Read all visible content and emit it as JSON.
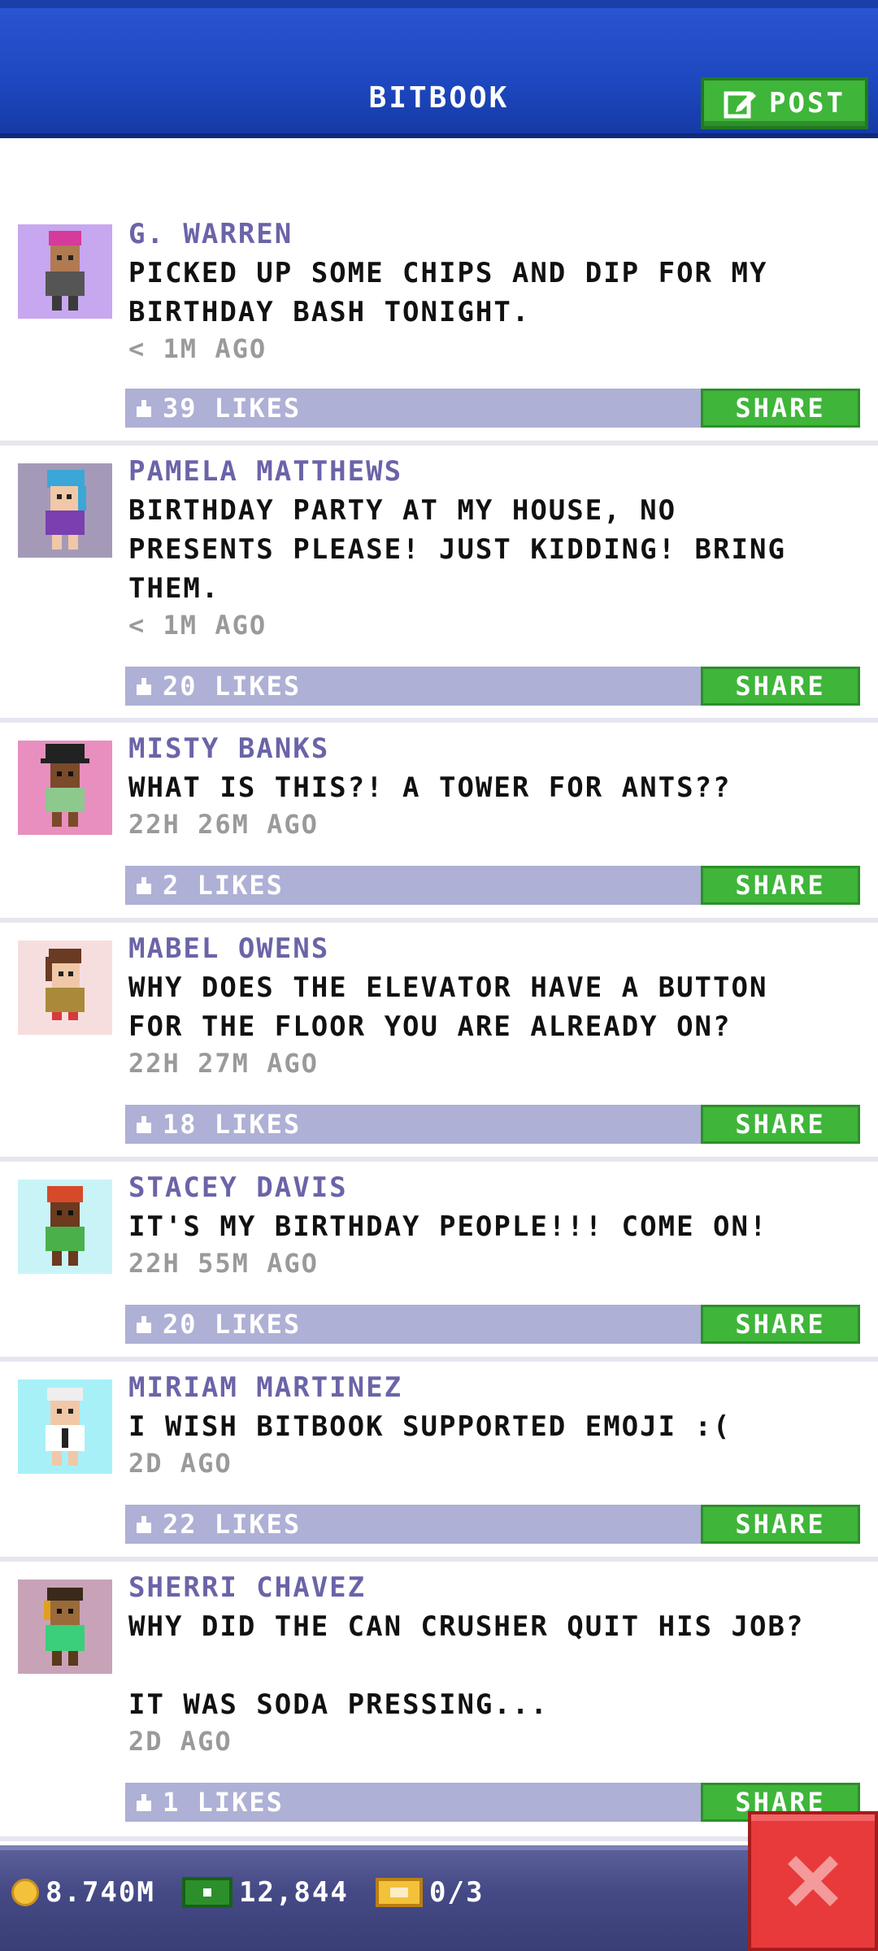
{
  "header": {
    "title": "BITBOOK",
    "post_label": "POST"
  },
  "feed": [
    {
      "author": "G. WARREN",
      "message": "PICKED UP SOME CHIPS AND DIP FOR MY\nBIRTHDAY BASH TONIGHT.",
      "time": "< 1M AGO",
      "likes": "39 LIKES",
      "share": "SHARE",
      "avatar": {
        "bg": "#c7a7ef",
        "hair": "#d63a9a",
        "skin": "#b07a52",
        "shirt": "#555555"
      }
    },
    {
      "author": "PAMELA MATTHEWS",
      "message": "BIRTHDAY PARTY AT MY HOUSE, NO\nPRESENTS PLEASE! JUST KIDDING! BRING\nTHEM.",
      "time": "< 1M AGO",
      "likes": "20 LIKES",
      "share": "SHARE",
      "avatar": {
        "bg": "#a49ab8",
        "hair": "#3aa7d6",
        "skin": "#f0c8a8",
        "shirt": "#7b3fb0"
      }
    },
    {
      "author": "MISTY BANKS",
      "message": "WHAT IS THIS?! A TOWER FOR ANTS??",
      "time": "22H 26M AGO",
      "likes": "2 LIKES",
      "share": "SHARE",
      "avatar": {
        "bg": "#e88fbf",
        "hair": "#222222",
        "skin": "#7a4a2a",
        "shirt": "#8dc88d"
      }
    },
    {
      "author": "MABEL OWENS",
      "message": "WHY DOES THE ELEVATOR HAVE A BUTTON\nFOR THE FLOOR YOU ARE ALREADY ON?",
      "time": "22H 27M AGO",
      "likes": "18 LIKES",
      "share": "SHARE",
      "avatar": {
        "bg": "#f7dede",
        "hair": "#6b3a22",
        "skin": "#f0c8a8",
        "shirt": "#a88a3a"
      }
    },
    {
      "author": "STACEY DAVIS",
      "message": "IT'S MY BIRTHDAY PEOPLE!!! COME ON!",
      "time": "22H 55M AGO",
      "likes": "20 LIKES",
      "share": "SHARE",
      "avatar": {
        "bg": "#c9f4f7",
        "hair": "#d64a2a",
        "skin": "#6b3a1f",
        "shirt": "#4ab04a"
      }
    },
    {
      "author": "MIRIAM MARTINEZ",
      "message": "I WISH BITBOOK SUPPORTED EMOJI :(",
      "time": "2D AGO",
      "likes": "22 LIKES",
      "share": "SHARE",
      "avatar": {
        "bg": "#a8f0f7",
        "hair": "#eeeeee",
        "skin": "#f0c8a8",
        "shirt": "#ffffff"
      }
    },
    {
      "author": "SHERRI CHAVEZ",
      "message": "WHY DID THE CAN CRUSHER QUIT HIS JOB?\n\nIT WAS SODA PRESSING...",
      "time": "2D AGO",
      "likes": "1 LIKES",
      "share": "SHARE",
      "avatar": {
        "bg": "#c8a3b8",
        "hair": "#3a2a1a",
        "skin": "#9a6a3a",
        "shirt": "#3acf7a"
      }
    }
  ],
  "status": {
    "coins": "8.740M",
    "cash": "12,844",
    "tickets": "0/3"
  },
  "colors": {
    "header_blue": "#1d48c0",
    "accent_green": "#3fb53a",
    "like_bar": "#aeb0d6",
    "author_purple": "#6a64a8",
    "close_red": "#e83a3a"
  },
  "icons": {
    "post": "edit-icon",
    "like": "thumbs-up-icon",
    "coins": "coin-icon",
    "cash": "cash-icon",
    "tickets": "ticket-icon",
    "close": "close-icon"
  }
}
